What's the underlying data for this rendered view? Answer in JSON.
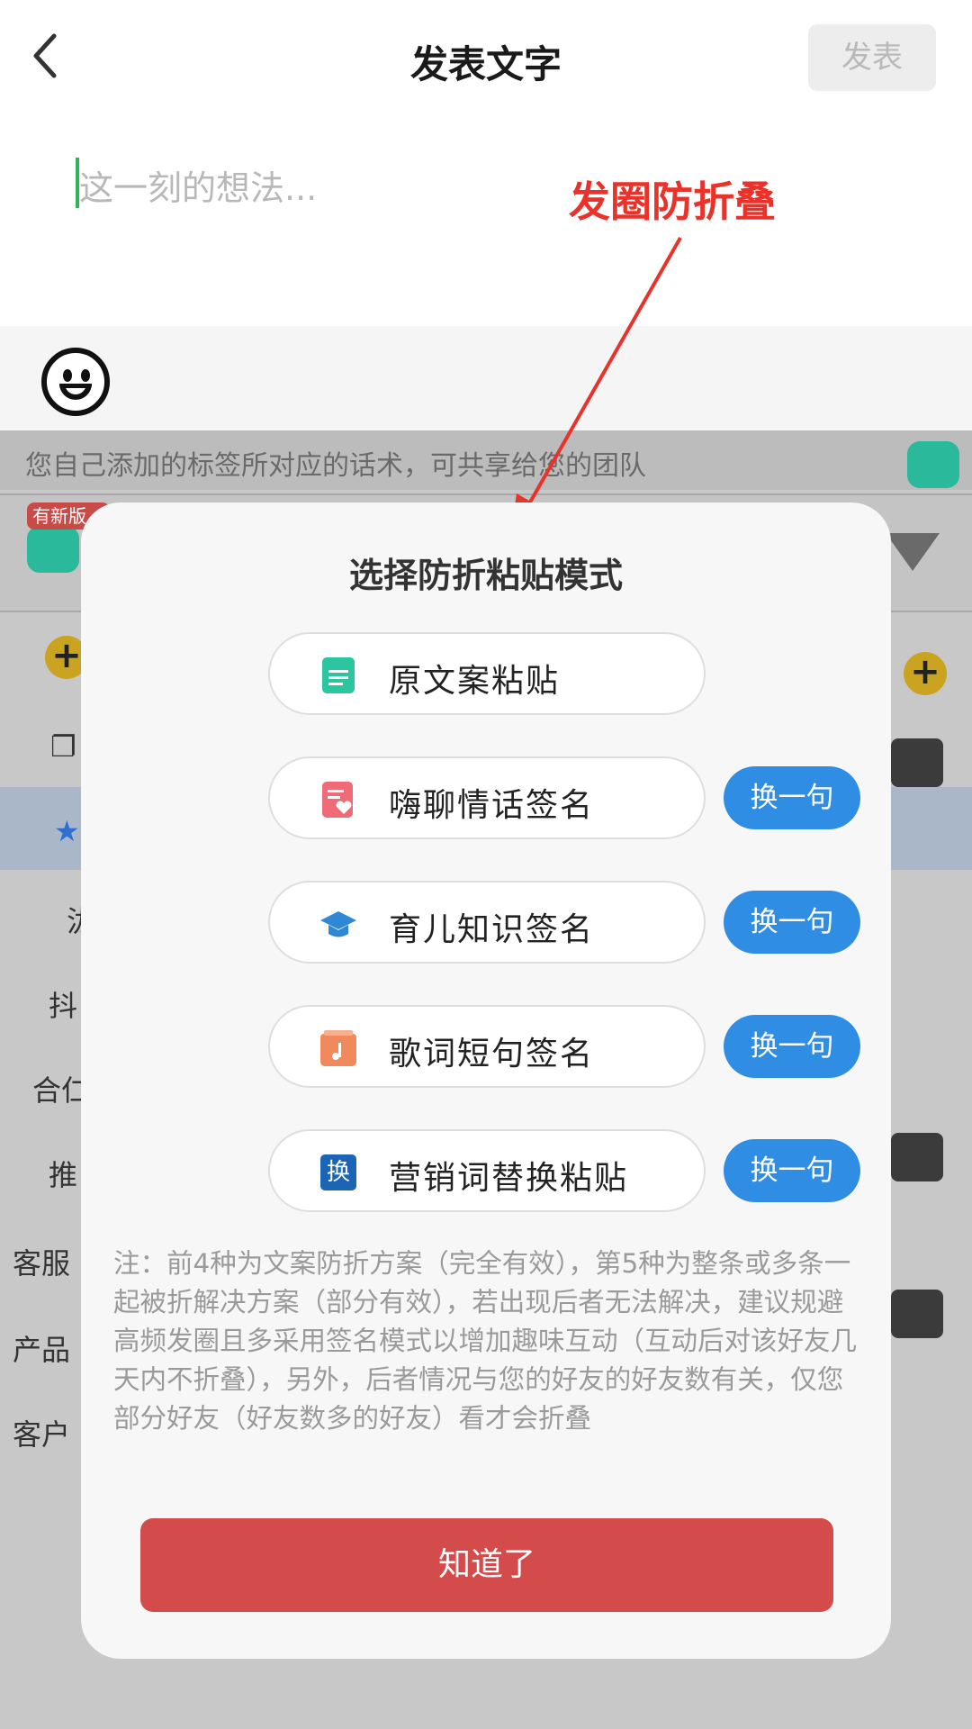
{
  "header": {
    "back_icon": "chevron-left-icon",
    "title": "发表文字",
    "publish_label": "发表"
  },
  "compose": {
    "placeholder": "这一刻的想法..."
  },
  "annotation": "发圈防折叠",
  "emoji_icon": "smiley-icon",
  "background_app": {
    "tip_text": "您自己添加的标签所对应的话术，可共享给您的团队",
    "new_badge": "有新版",
    "left_partial_labels": [
      "❐",
      "★",
      "泷",
      "抖",
      "合仁",
      "推",
      "客服",
      "产品",
      "客户"
    ],
    "bot_label": "chat"
  },
  "modal": {
    "title": "选择防折粘贴模式",
    "options": [
      {
        "label": "原文案粘贴",
        "icon": "document-icon",
        "icon_color": "#2bc6a0",
        "swap": null
      },
      {
        "label": "嗨聊情话签名",
        "icon": "love-note-icon",
        "icon_color": "#ef6b77",
        "swap": "换一句"
      },
      {
        "label": "育儿知识签名",
        "icon": "graduation-cap-icon",
        "icon_color": "#2f88d6",
        "swap": "换一句"
      },
      {
        "label": "歌词短句签名",
        "icon": "music-box-icon",
        "icon_color": "#f08a5d",
        "swap": "换一句"
      },
      {
        "label": "营销词替换粘贴",
        "icon": "replace-icon",
        "icon_glyph": "换",
        "icon_color": "#1c64b4",
        "swap": "换一句"
      }
    ],
    "note": "注：前4种为文案防折方案（完全有效），第5种为整条或多条一起被折解决方案（部分有效），若出现后者无法解决，建议规避高频发圈且多采用签名模式以增加趣味互动（互动后对该好友几天内不折叠），另外，后者情况与您的好友的好友数有关，仅您部分好友（好友数多的好友）看才会折叠",
    "ok_label": "知道了"
  },
  "colors": {
    "accent_red": "#d34b4b",
    "swap_blue": "#2f8de4",
    "annotation_red": "#e8322a"
  }
}
